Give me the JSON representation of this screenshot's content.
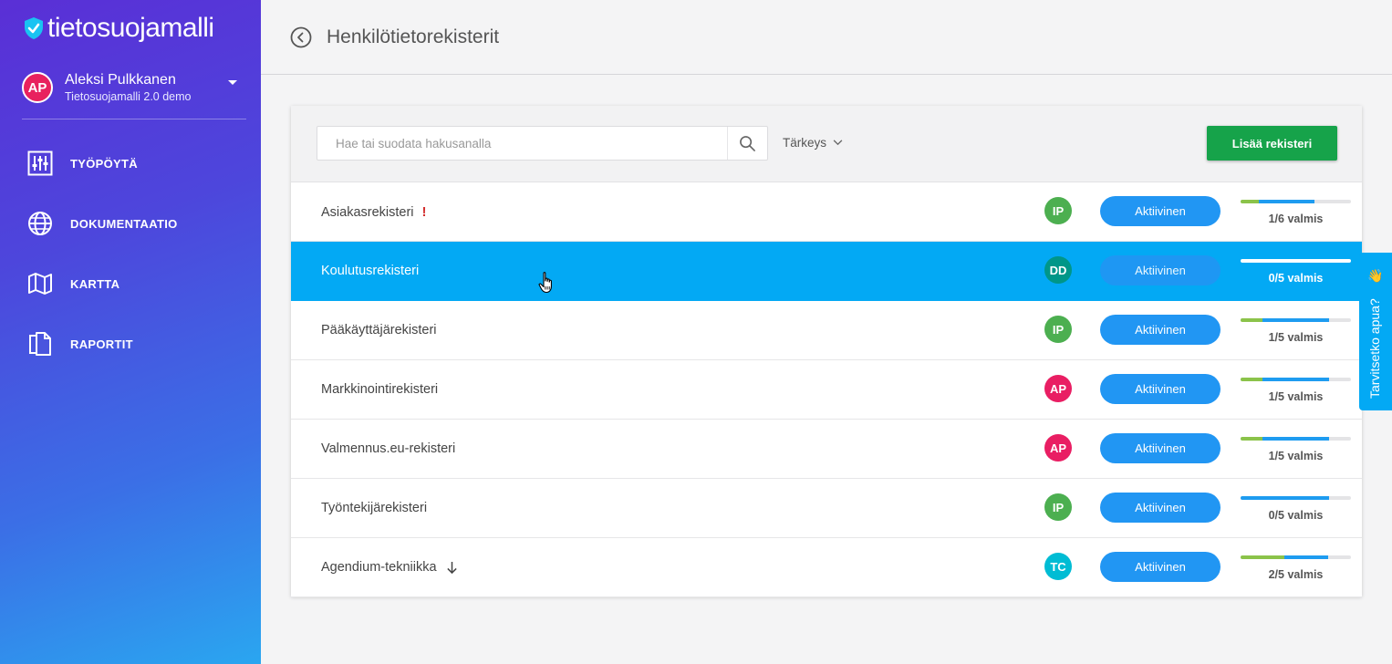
{
  "sidebar": {
    "logo_text": "tietosuojamalli",
    "user": {
      "initials": "AP",
      "name": "Aleksi Pulkkanen",
      "org": "Tietosuojamalli 2.0 demo"
    },
    "nav": [
      {
        "label": "TYÖPÖYTÄ",
        "icon": "sliders-icon"
      },
      {
        "label": "DOKUMENTAATIO",
        "icon": "globe-icon"
      },
      {
        "label": "KARTTA",
        "icon": "map-icon"
      },
      {
        "label": "RAPORTIT",
        "icon": "documents-icon"
      }
    ]
  },
  "header": {
    "title": "Henkilötietorekisterit"
  },
  "toolbar": {
    "search_placeholder": "Hae tai suodata hakusanalla",
    "filter_label": "Tärkeys",
    "add_label": "Lisää rekisteri"
  },
  "rows": [
    {
      "name": "Asiakasrekisteri",
      "flag": "!",
      "owner": "IP",
      "owner_color": "#4caf50",
      "status": "Aktiivinen",
      "progress_label": "1/6 valmis",
      "done_fraction": 0.167,
      "active_fraction": 0.5,
      "selected": false
    },
    {
      "name": "Koulutusrekisteri",
      "owner": "DD",
      "owner_color": "#009688",
      "status": "Aktiivinen",
      "progress_label": "0/5 valmis",
      "done_fraction": 0,
      "active_fraction": 0,
      "selected": true
    },
    {
      "name": "Pääkäyttäjärekisteri",
      "owner": "IP",
      "owner_color": "#4caf50",
      "status": "Aktiivinen",
      "progress_label": "1/5 valmis",
      "done_fraction": 0.2,
      "active_fraction": 0.6,
      "selected": false
    },
    {
      "name": "Markkinointirekisteri",
      "owner": "AP",
      "owner_color": "#e91e63",
      "status": "Aktiivinen",
      "progress_label": "1/5 valmis",
      "done_fraction": 0.2,
      "active_fraction": 0.6,
      "selected": false
    },
    {
      "name": "Valmennus.eu-rekisteri",
      "owner": "AP",
      "owner_color": "#e91e63",
      "status": "Aktiivinen",
      "progress_label": "1/5 valmis",
      "done_fraction": 0.2,
      "active_fraction": 0.6,
      "selected": false
    },
    {
      "name": "Työntekijärekisteri",
      "owner": "IP",
      "owner_color": "#4caf50",
      "status": "Aktiivinen",
      "progress_label": "0/5 valmis",
      "done_fraction": 0,
      "active_fraction": 0.8,
      "selected": false
    },
    {
      "name": "Agendium-tekniikka",
      "arrow": "down",
      "owner": "TC",
      "owner_color": "#00bcd4",
      "status": "Aktiivinen",
      "progress_label": "2/5 valmis",
      "done_fraction": 0.4,
      "active_fraction": 0.4,
      "selected": false
    }
  ],
  "help": {
    "label": "Tarvitsetko apua?",
    "emoji": "👋"
  },
  "colors": {
    "accent": "#03a9f4",
    "primary_button": "#16a34a",
    "status_button": "#2196f3"
  }
}
